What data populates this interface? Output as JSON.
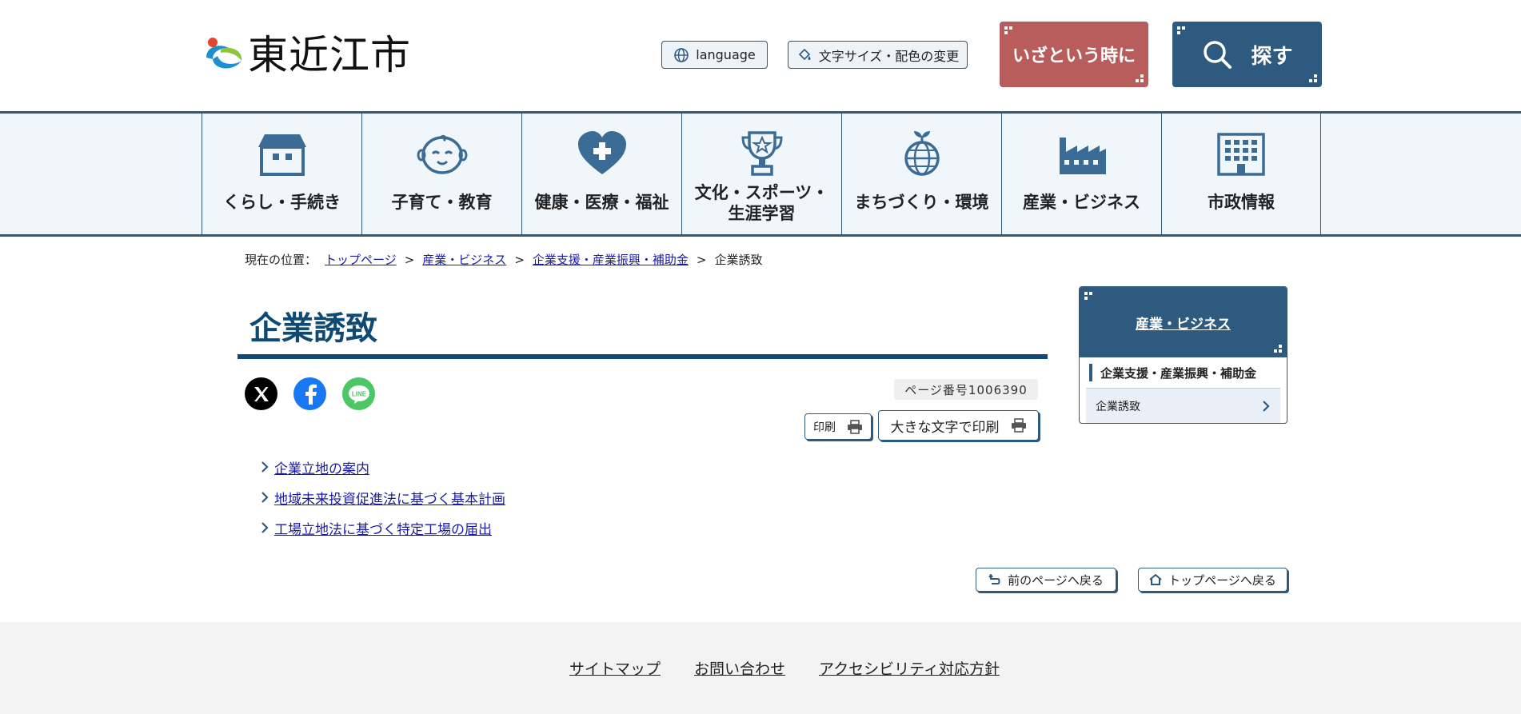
{
  "header": {
    "logo_text": "東近江市",
    "language_label": "language",
    "text_size_label": "文字サイズ・配色の変更",
    "emergency_label": "いざという時に",
    "search_label": "探す"
  },
  "gnav": {
    "items": [
      {
        "label": "くらし・手続き",
        "icon": "house-icon"
      },
      {
        "label": "子育て・教育",
        "icon": "baby-face-icon"
      },
      {
        "label": "健康・医療・福祉",
        "icon": "heart-cross-icon"
      },
      {
        "label": "文化・スポーツ・\n生涯学習",
        "icon": "trophy-icon"
      },
      {
        "label": "まちづくり・環境",
        "icon": "globe-sprout-icon"
      },
      {
        "label": "産業・ビジネス",
        "icon": "factory-icon"
      },
      {
        "label": "市政情報",
        "icon": "building-icon"
      }
    ]
  },
  "breadcrumb": {
    "prefix": "現在の位置：",
    "items": [
      "トップページ",
      "産業・ビジネス",
      "企業支援・産業振興・補助金"
    ],
    "current": "企業誘致",
    "separator": ">"
  },
  "main": {
    "title": "企業誘致",
    "page_number": "ページ番号1006390",
    "print_label": "印刷",
    "print_large_label": "大きな文字で印刷",
    "links": [
      "企業立地の案内",
      "地域未来投資促進法に基づく基本計画",
      "工場立地法に基づく特定工場の届出"
    ],
    "back_label": "前のページへ戻る",
    "top_label": "トップページへ戻る"
  },
  "side": {
    "heading": "産業・ビジネス",
    "category": "企業支援・産業振興・補助金",
    "current": "企業誘致"
  },
  "footer": {
    "links": [
      "サイトマップ",
      "お問い合わせ",
      "アクセシビリティ対応方針"
    ]
  },
  "colors": {
    "primary": "#2f5a80",
    "title": "#0e4a73",
    "emergency": "#b85c5c",
    "nav_bg": "#f1f6fa",
    "link": "#1a1aaa"
  }
}
